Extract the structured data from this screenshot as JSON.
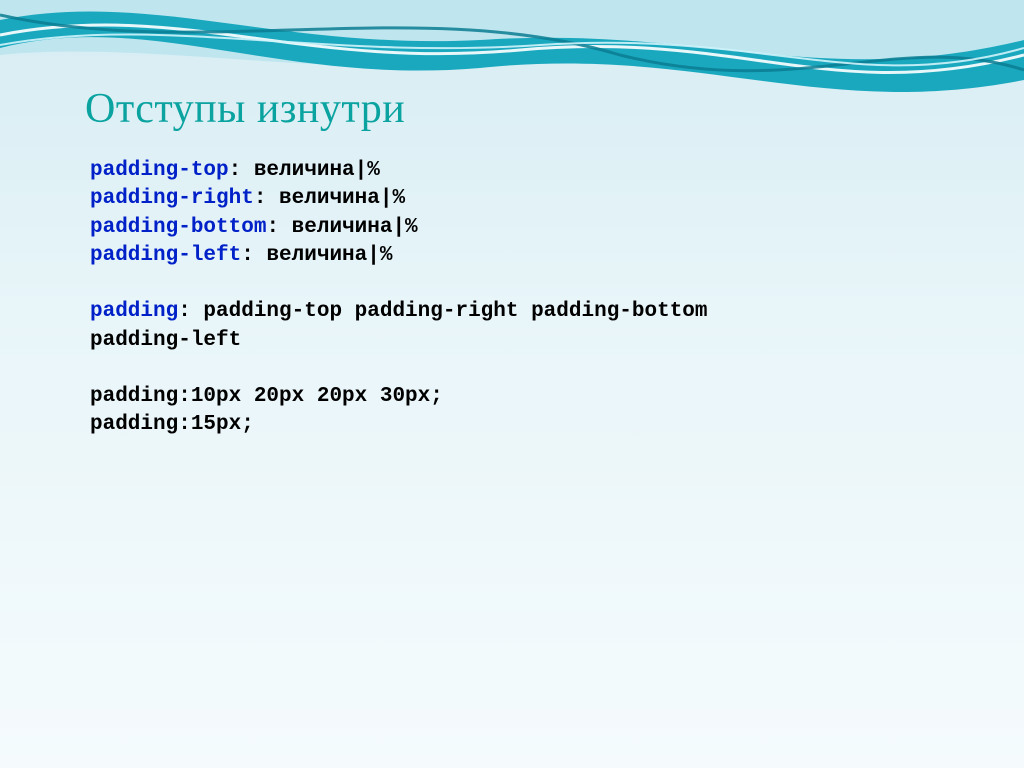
{
  "title": "Отступы изнутри",
  "lines": {
    "l1": {
      "kw": "padding-top",
      "rest": ": величина|%"
    },
    "l2": {
      "kw": "padding-right",
      "rest": ": величина|%"
    },
    "l3": {
      "kw": "padding-bottom",
      "rest": ": величина|%"
    },
    "l4": {
      "kw": "padding-left",
      "rest": ": величина|%"
    },
    "l5": {
      "kw": "padding",
      "rest": ": padding-top padding-right padding-bottom"
    },
    "l6": "padding-left",
    "l7": "padding:10px 20px 20px 30px;",
    "l8": "padding:15px;"
  }
}
